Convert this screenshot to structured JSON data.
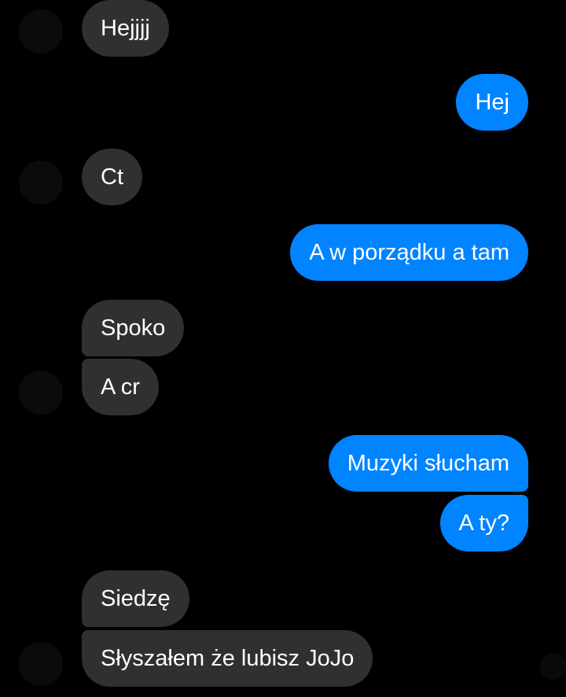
{
  "conversation": {
    "messages": [
      {
        "sender": "other",
        "text": "Hejjjj"
      },
      {
        "sender": "me",
        "text": "Hej"
      },
      {
        "sender": "other",
        "text": "Ct"
      },
      {
        "sender": "me",
        "text": "A w porządku a tam"
      },
      {
        "sender": "other",
        "text": "Spoko"
      },
      {
        "sender": "other",
        "text": "A cr"
      },
      {
        "sender": "me",
        "text": "Muzyki słucham"
      },
      {
        "sender": "me",
        "text": "A ty?"
      },
      {
        "sender": "other",
        "text": "Siedzę"
      },
      {
        "sender": "other",
        "text": "Słyszałem że lubisz JoJo"
      }
    ]
  },
  "colors": {
    "background": "#000000",
    "incoming_bubble": "#303030",
    "outgoing_bubble": "#0084ff",
    "text": "#ffffff"
  }
}
